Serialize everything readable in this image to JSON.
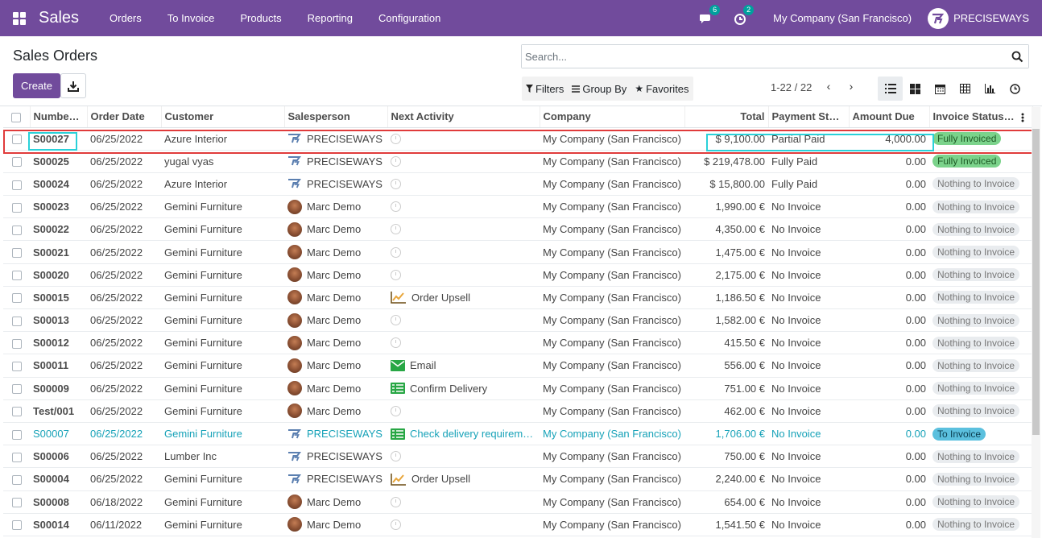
{
  "navbar": {
    "app_name": "Sales",
    "menu": [
      "Orders",
      "To Invoice",
      "Products",
      "Reporting",
      "Configuration"
    ],
    "messages_badge": "6",
    "activities_badge": "2",
    "company": "My Company (San Francisco)",
    "brand": "PRECISEWAYS",
    "bg_color": "#714b9c"
  },
  "control_panel": {
    "title": "Sales Orders",
    "create_label": "Create",
    "search_placeholder": "Search...",
    "filters_label": "Filters",
    "group_by_label": "Group By",
    "favorites_label": "Favorites",
    "pager": "1-22 / 22"
  },
  "table": {
    "headers": [
      "Numbe…",
      "Order Date",
      "Customer",
      "Salesperson",
      "Next Activity",
      "Company",
      "Total",
      "Payment Stat…",
      "Amount Due",
      "Invoice Status…"
    ],
    "rows": [
      {
        "number": "S00027",
        "date": "06/25/2022",
        "customer": "Azure Interior",
        "salesperson": "PRECISEWAYS",
        "sp_type": "logo",
        "activity": "",
        "activity_icon": "clock",
        "company": "My Company (San Francisco)",
        "total": "$ 9,100.00",
        "payment": "Partial Paid",
        "due": "4,000.00",
        "status": "Fully Invoiced",
        "status_type": "green",
        "style": "normal"
      },
      {
        "number": "S00025",
        "date": "06/25/2022",
        "customer": "yugal vyas",
        "salesperson": "PRECISEWAYS",
        "sp_type": "logo",
        "activity": "",
        "activity_icon": "clock",
        "company": "My Company (San Francisco)",
        "total": "$ 219,478.00",
        "payment": "Fully Paid",
        "due": "0.00",
        "status": "Fully Invoiced",
        "status_type": "green",
        "style": "normal"
      },
      {
        "number": "S00024",
        "date": "06/25/2022",
        "customer": "Azure Interior",
        "salesperson": "PRECISEWAYS",
        "sp_type": "logo",
        "activity": "",
        "activity_icon": "clock",
        "company": "My Company (San Francisco)",
        "total": "$ 15,800.00",
        "payment": "Fully Paid",
        "due": "0.00",
        "status": "Nothing to Invoice",
        "status_type": "gray",
        "style": "normal"
      },
      {
        "number": "S00023",
        "date": "06/25/2022",
        "customer": "Gemini Furniture",
        "salesperson": "Marc Demo",
        "sp_type": "avatar",
        "activity": "",
        "activity_icon": "clock",
        "company": "My Company (San Francisco)",
        "total": "1,990.00 €",
        "payment": "No Invoice",
        "due": "0.00",
        "status": "Nothing to Invoice",
        "status_type": "gray",
        "style": "normal"
      },
      {
        "number": "S00022",
        "date": "06/25/2022",
        "customer": "Gemini Furniture",
        "salesperson": "Marc Demo",
        "sp_type": "avatar",
        "activity": "",
        "activity_icon": "clock",
        "company": "My Company (San Francisco)",
        "total": "4,350.00 €",
        "payment": "No Invoice",
        "due": "0.00",
        "status": "Nothing to Invoice",
        "status_type": "gray",
        "style": "normal"
      },
      {
        "number": "S00021",
        "date": "06/25/2022",
        "customer": "Gemini Furniture",
        "salesperson": "Marc Demo",
        "sp_type": "avatar",
        "activity": "",
        "activity_icon": "clock",
        "company": "My Company (San Francisco)",
        "total": "1,475.00 €",
        "payment": "No Invoice",
        "due": "0.00",
        "status": "Nothing to Invoice",
        "status_type": "gray",
        "style": "normal"
      },
      {
        "number": "S00020",
        "date": "06/25/2022",
        "customer": "Gemini Furniture",
        "salesperson": "Marc Demo",
        "sp_type": "avatar",
        "activity": "",
        "activity_icon": "clock",
        "company": "My Company (San Francisco)",
        "total": "2,175.00 €",
        "payment": "No Invoice",
        "due": "0.00",
        "status": "Nothing to Invoice",
        "status_type": "gray",
        "style": "normal"
      },
      {
        "number": "S00015",
        "date": "06/25/2022",
        "customer": "Gemini Furniture",
        "salesperson": "Marc Demo",
        "sp_type": "avatar",
        "activity": "Order Upsell",
        "activity_icon": "upsell",
        "company": "My Company (San Francisco)",
        "total": "1,186.50 €",
        "payment": "No Invoice",
        "due": "0.00",
        "status": "Nothing to Invoice",
        "status_type": "gray",
        "style": "normal"
      },
      {
        "number": "S00013",
        "date": "06/25/2022",
        "customer": "Gemini Furniture",
        "salesperson": "Marc Demo",
        "sp_type": "avatar",
        "activity": "",
        "activity_icon": "clock",
        "company": "My Company (San Francisco)",
        "total": "1,582.00 €",
        "payment": "No Invoice",
        "due": "0.00",
        "status": "Nothing to Invoice",
        "status_type": "gray",
        "style": "normal"
      },
      {
        "number": "S00012",
        "date": "06/25/2022",
        "customer": "Gemini Furniture",
        "salesperson": "Marc Demo",
        "sp_type": "avatar",
        "activity": "",
        "activity_icon": "clock",
        "company": "My Company (San Francisco)",
        "total": "415.50 €",
        "payment": "No Invoice",
        "due": "0.00",
        "status": "Nothing to Invoice",
        "status_type": "gray",
        "style": "normal"
      },
      {
        "number": "S00011",
        "date": "06/25/2022",
        "customer": "Gemini Furniture",
        "salesperson": "Marc Demo",
        "sp_type": "avatar",
        "activity": "Email",
        "activity_icon": "email",
        "company": "My Company (San Francisco)",
        "total": "556.00 €",
        "payment": "No Invoice",
        "due": "0.00",
        "status": "Nothing to Invoice",
        "status_type": "gray",
        "style": "normal"
      },
      {
        "number": "S00009",
        "date": "06/25/2022",
        "customer": "Gemini Furniture",
        "salesperson": "Marc Demo",
        "sp_type": "avatar",
        "activity": "Confirm Delivery",
        "activity_icon": "tasks",
        "company": "My Company (San Francisco)",
        "total": "751.00 €",
        "payment": "No Invoice",
        "due": "0.00",
        "status": "Nothing to Invoice",
        "status_type": "gray",
        "style": "normal"
      },
      {
        "number": "Test/001",
        "date": "06/25/2022",
        "customer": "Gemini Furniture",
        "salesperson": "Marc Demo",
        "sp_type": "avatar",
        "activity": "",
        "activity_icon": "clock",
        "company": "My Company (San Francisco)",
        "total": "462.00 €",
        "payment": "No Invoice",
        "due": "0.00",
        "status": "Nothing to Invoice",
        "status_type": "gray",
        "style": "normal"
      },
      {
        "number": "S00007",
        "date": "06/25/2022",
        "customer": "Gemini Furniture",
        "salesperson": "PRECISEWAYS",
        "sp_type": "logo",
        "activity": "Check delivery requirem…",
        "activity_icon": "tasks",
        "company": "My Company (San Francisco)",
        "total": "1,706.00 €",
        "payment": "No Invoice",
        "due": "0.00",
        "status": "To Invoice",
        "status_type": "teal",
        "style": "info"
      },
      {
        "number": "S00006",
        "date": "06/25/2022",
        "customer": "Lumber Inc",
        "salesperson": "PRECISEWAYS",
        "sp_type": "logo",
        "activity": "",
        "activity_icon": "clock",
        "company": "My Company (San Francisco)",
        "total": "750.00 €",
        "payment": "No Invoice",
        "due": "0.00",
        "status": "Nothing to Invoice",
        "status_type": "gray",
        "style": "normal"
      },
      {
        "number": "S00004",
        "date": "06/25/2022",
        "customer": "Gemini Furniture",
        "salesperson": "PRECISEWAYS",
        "sp_type": "logo",
        "activity": "Order Upsell",
        "activity_icon": "upsell",
        "company": "My Company (San Francisco)",
        "total": "2,240.00 €",
        "payment": "No Invoice",
        "due": "0.00",
        "status": "Nothing to Invoice",
        "status_type": "gray",
        "style": "normal"
      },
      {
        "number": "S00008",
        "date": "06/18/2022",
        "customer": "Gemini Furniture",
        "salesperson": "Marc Demo",
        "sp_type": "avatar",
        "activity": "",
        "activity_icon": "clock",
        "company": "My Company (San Francisco)",
        "total": "654.00 €",
        "payment": "No Invoice",
        "due": "0.00",
        "status": "Nothing to Invoice",
        "status_type": "gray",
        "style": "normal"
      },
      {
        "number": "S00014",
        "date": "06/11/2022",
        "customer": "Gemini Furniture",
        "salesperson": "Marc Demo",
        "sp_type": "avatar",
        "activity": "",
        "activity_icon": "clock",
        "company": "My Company (San Francisco)",
        "total": "1,541.50 €",
        "payment": "No Invoice",
        "due": "0.00",
        "status": "Nothing to Invoice",
        "status_type": "gray",
        "style": "normal"
      }
    ]
  }
}
